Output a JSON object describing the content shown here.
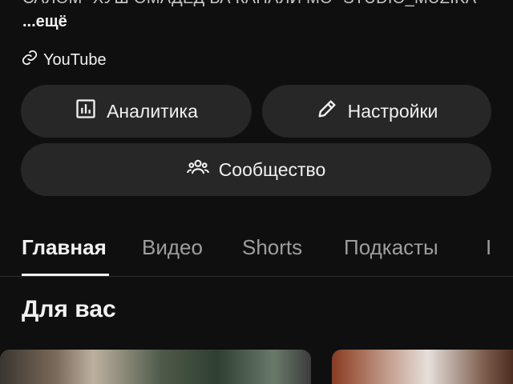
{
  "channel": {
    "description_line": "САЛОМ \"ХУШ ОМАДЕД БА КАНАЛИ МО\" STUDIO_MUZIKA",
    "more_label": "...ещё",
    "link_label": "YouTube"
  },
  "actions": {
    "analytics_label": "Аналитика",
    "settings_label": "Настройки",
    "community_label": "Сообщество"
  },
  "tabs": [
    {
      "label": "Главная",
      "active": true
    },
    {
      "label": "Видео",
      "active": false
    },
    {
      "label": "Shorts",
      "active": false
    },
    {
      "label": "Подкасты",
      "active": false
    },
    {
      "label": "I",
      "active": false
    }
  ],
  "feed": {
    "section_title": "Для вас"
  },
  "colors": {
    "background": "#0f0f0f",
    "button_bg": "#272727",
    "text_primary": "#f1f1f1",
    "text_secondary": "#9e9e9e"
  }
}
